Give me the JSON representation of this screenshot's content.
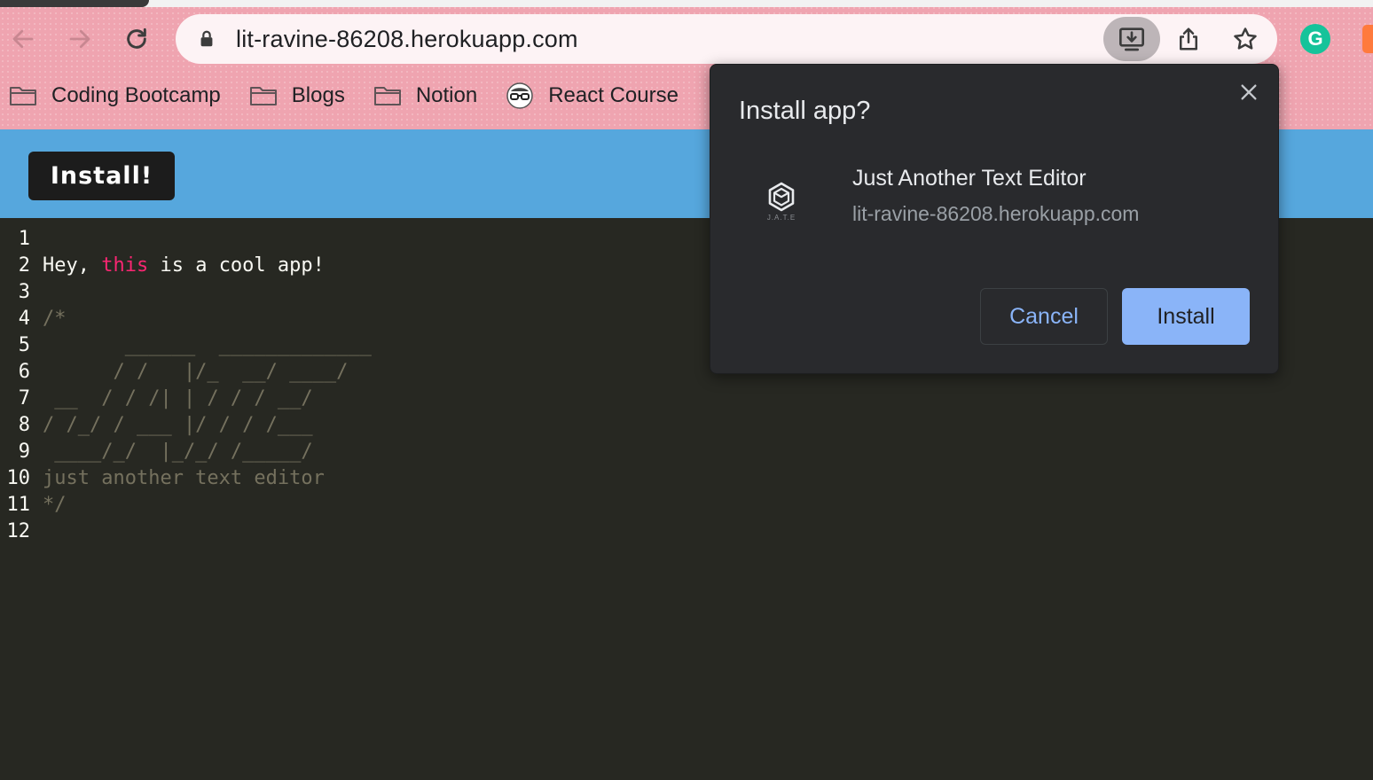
{
  "browser": {
    "url": "lit-ravine-86208.herokuapp.com",
    "toolbar_icons": [
      "back-icon",
      "forward-icon",
      "reload-icon",
      "lock-icon",
      "install-app-icon",
      "share-icon",
      "bookmark-star-icon",
      "grammarly-icon",
      "extension-icon"
    ],
    "bookmarks": [
      {
        "label": "Coding Bootcamp",
        "icon": "folder-icon"
      },
      {
        "label": "Blogs",
        "icon": "folder-icon"
      },
      {
        "label": "Notion",
        "icon": "folder-icon"
      },
      {
        "label": "React Course",
        "icon": "glasses-icon"
      }
    ],
    "grammarly_letter": "G",
    "theme_color": "#efa4b0"
  },
  "app": {
    "install_button_label": "Install!",
    "header_color": "#56a7dd",
    "editor_bg": "#272822"
  },
  "editor": {
    "lines": [
      {
        "num": "1",
        "segments": []
      },
      {
        "num": "2",
        "segments": [
          {
            "text": "Hey, ",
            "style": "plain"
          },
          {
            "text": "this",
            "style": "keyword"
          },
          {
            "text": " is a cool app!",
            "style": "plain"
          }
        ]
      },
      {
        "num": "3",
        "segments": []
      },
      {
        "num": "4",
        "segments": [
          {
            "text": "/*",
            "style": "comment"
          }
        ]
      },
      {
        "num": "5",
        "segments": [
          {
            "text": "       ______  _____________",
            "style": "comment"
          }
        ]
      },
      {
        "num": "6",
        "segments": [
          {
            "text": "      / /   |/_  __/ ____/",
            "style": "comment"
          }
        ]
      },
      {
        "num": "7",
        "segments": [
          {
            "text": " __  / / /| | / / / __/",
            "style": "comment"
          }
        ]
      },
      {
        "num": "8",
        "segments": [
          {
            "text": "/ /_/ / ___ |/ / / /___",
            "style": "comment"
          }
        ]
      },
      {
        "num": "9",
        "segments": [
          {
            "text": " ____/_/  |_/_/ /_____/",
            "style": "comment"
          }
        ]
      },
      {
        "num": "10",
        "segments": [
          {
            "text": "just another text editor",
            "style": "comment"
          }
        ]
      },
      {
        "num": "11",
        "segments": [
          {
            "text": "*/",
            "style": "comment"
          }
        ]
      },
      {
        "num": "12",
        "segments": []
      }
    ]
  },
  "dialog": {
    "title": "Install app?",
    "app_name": "Just Another Text Editor",
    "app_origin": "lit-ravine-86208.herokuapp.com",
    "app_icon_label": "J.A.T.E",
    "cancel_label": "Cancel",
    "install_label": "Install",
    "accent_color": "#8ab4f8"
  }
}
